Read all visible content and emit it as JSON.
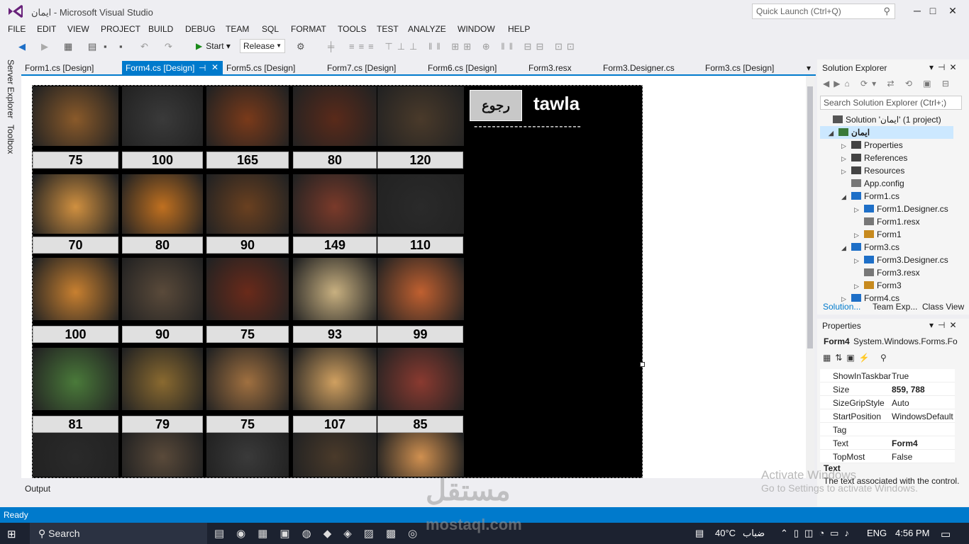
{
  "window": {
    "title": "ايمان - Microsoft Visual Studio",
    "quick_launch_placeholder": "Quick Launch (Ctrl+Q)",
    "min": "─",
    "max": "□",
    "close": "✕"
  },
  "menu": [
    "FILE",
    "EDIT",
    "VIEW",
    "PROJECT",
    "BUILD",
    "DEBUG",
    "TEAM",
    "SQL",
    "FORMAT",
    "TOOLS",
    "TEST",
    "ANALYZE",
    "WINDOW",
    "HELP"
  ],
  "toolbar": {
    "start_label": "Start",
    "config_value": "Release"
  },
  "left_tabs": [
    "Server Explorer",
    "Toolbox"
  ],
  "doc_tabs": [
    {
      "label": "Form1.cs [Design]"
    },
    {
      "label": "Form4.cs [Design]"
    },
    {
      "label": "Form5.cs [Design]"
    },
    {
      "label": "Form7.cs [Design]"
    },
    {
      "label": "Form6.cs [Design]"
    },
    {
      "label": "Form3.resx"
    },
    {
      "label": "Form3.Designer.cs"
    },
    {
      "label": "Form3.cs [Design]"
    }
  ],
  "form": {
    "back_button": "رجوع",
    "title": "tawla",
    "underline": "------------------------",
    "prices": [
      "75",
      "100",
      "165",
      "80",
      "120",
      "70",
      "80",
      "90",
      "149",
      "110",
      "100",
      "90",
      "75",
      "93",
      "99",
      "81",
      "79",
      "75",
      "107",
      "85"
    ],
    "image_colors": [
      "#8a5a2a",
      "#3a3a3a",
      "#7a3a1a",
      "#5a2a1a",
      "#4a3a2a",
      "#d09040",
      "#c07020",
      "#6a4020",
      "#7a3a2a",
      "#2a2a2a",
      "#c88030",
      "#5a4a3a",
      "#6a2a1a",
      "#c8b080",
      "#c06030",
      "#4a7a3a",
      "#8a6a30",
      "#a07040",
      "#d0a060",
      "#8a3a30",
      "#2a2a2a",
      "#5a4a3a",
      "#3a3a3a",
      "#4a3a2a",
      "#d09050"
    ]
  },
  "output_label": "Output",
  "solution_explorer": {
    "title": "Solution Explorer",
    "search_placeholder": "Search Solution Explorer (Ctrl+;)",
    "items": [
      {
        "label": "Solution 'ايمان' (1 project)"
      },
      {
        "label": "ايمان"
      },
      {
        "label": "Properties"
      },
      {
        "label": "References"
      },
      {
        "label": "Resources"
      },
      {
        "label": "App.config"
      },
      {
        "label": "Form1.cs"
      },
      {
        "label": "Form1.Designer.cs"
      },
      {
        "label": "Form1.resx"
      },
      {
        "label": "Form1"
      },
      {
        "label": "Form3.cs"
      },
      {
        "label": "Form3.Designer.cs"
      },
      {
        "label": "Form3.resx"
      },
      {
        "label": "Form3"
      },
      {
        "label": "Form4.cs"
      }
    ],
    "tabs": [
      "Solution...",
      "Team Exp...",
      "Class View"
    ]
  },
  "properties": {
    "title": "Properties",
    "object": "Form4",
    "object_type": "System.Windows.Forms.Fo",
    "rows": [
      {
        "name": "ShowInTaskbar",
        "value": "True"
      },
      {
        "name": "Size",
        "value": "859, 788"
      },
      {
        "name": "SizeGripStyle",
        "value": "Auto"
      },
      {
        "name": "StartPosition",
        "value": "WindowsDefault"
      },
      {
        "name": "Tag",
        "value": ""
      },
      {
        "name": "Text",
        "value": "Form4"
      },
      {
        "name": "TopMost",
        "value": "False"
      }
    ],
    "desc_title": "Text",
    "desc_text": "The text associated with the control."
  },
  "status": {
    "text": "Ready"
  },
  "watermark": {
    "line1": "Activate Windows",
    "line2": "Go to Settings to activate Windows."
  },
  "brand_watermark": {
    "arabic": "مستقل",
    "latin": "mostaql.com"
  },
  "taskbar": {
    "search": "Search",
    "weather": "40°C",
    "weather_desc": "ضباب",
    "lang": "ENG",
    "time": "4:56 PM"
  }
}
